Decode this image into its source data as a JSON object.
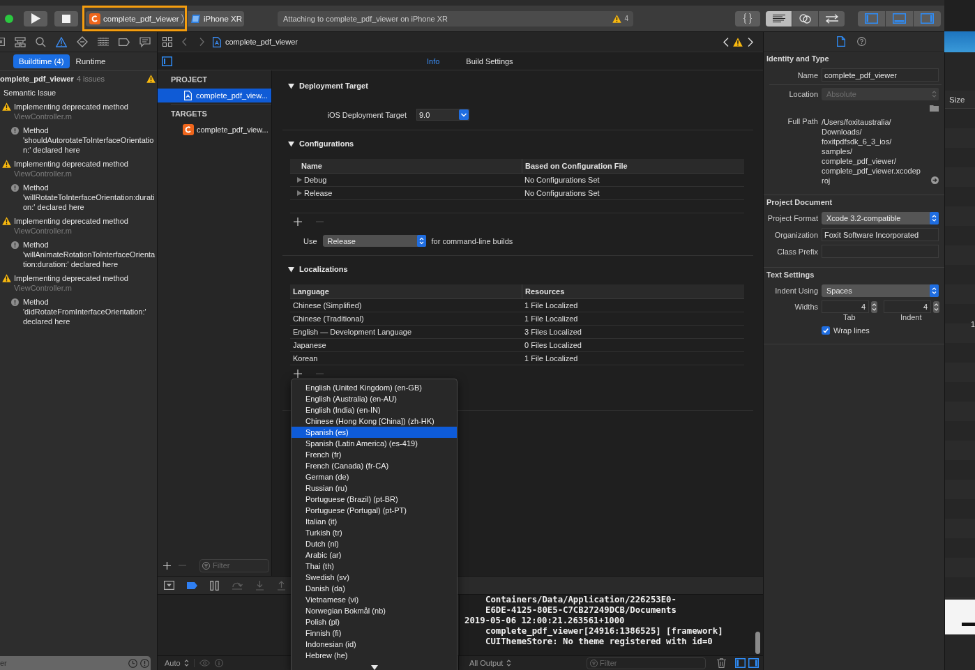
{
  "toolbar": {
    "scheme": "complete_pdf_viewer",
    "device": "iPhone XR",
    "activity": "Attaching to complete_pdf_viewer on iPhone XR",
    "warning_count": "4",
    "editor_modes": [
      {
        "kind": "standard",
        "selected": true
      },
      {
        "kind": "assistant",
        "selected": false
      },
      {
        "kind": "version",
        "selected": false
      }
    ],
    "panels": [
      {
        "kind": "navigator",
        "on": true
      },
      {
        "kind": "debug",
        "on": true
      },
      {
        "kind": "inspector",
        "on": true
      }
    ]
  },
  "navigator": {
    "icons": [
      {
        "kind": "project",
        "selected": false
      },
      {
        "kind": "symbols",
        "selected": false
      },
      {
        "kind": "find",
        "selected": false
      },
      {
        "kind": "issues",
        "selected": true
      },
      {
        "kind": "tests",
        "selected": false
      },
      {
        "kind": "debug",
        "selected": false
      },
      {
        "kind": "breakpoints",
        "selected": false
      },
      {
        "kind": "reports",
        "selected": false
      }
    ],
    "tabs": [
      {
        "label": "Buildtime (4)",
        "selected": true
      },
      {
        "label": "Runtime",
        "selected": false
      }
    ],
    "project": "omplete_pdf_viewer",
    "issue_count": "4 issues",
    "groups": [
      {
        "title": "Semantic Issue",
        "children": [
          {
            "kind": "warning",
            "message": "Implementing deprecated method",
            "file": "ViewController.m",
            "children": [
              {
                "kind": "note",
                "message": "Method 'shouldAutorotateToInterfaceOrientation:' declared here"
              }
            ]
          },
          {
            "kind": "warning",
            "message": "Implementing deprecated method",
            "file": "ViewController.m",
            "children": [
              {
                "kind": "note",
                "message": "Method 'willRotateToInterfaceOrientation:duration:' declared here"
              }
            ]
          },
          {
            "kind": "warning",
            "message": "Implementing deprecated method",
            "file": "ViewController.m",
            "children": [
              {
                "kind": "note",
                "message": "Method 'willAnimateRotationToInterfaceOrientation:duration:' declared here"
              }
            ]
          },
          {
            "kind": "warning",
            "message": "Implementing deprecated method",
            "file": "ViewController.m",
            "children": [
              {
                "kind": "note",
                "message": "Method 'didRotateFromInterfaceOrientation:' declared here"
              }
            ]
          }
        ]
      }
    ],
    "filter_placeholder": "er"
  },
  "editor": {
    "jump_bar": {
      "file": "complete_pdf_viewer"
    },
    "sidebar_on": true,
    "tabs": [
      {
        "label": "Info",
        "selected": true
      },
      {
        "label": "Build Settings",
        "selected": false
      }
    ],
    "targets_list": {
      "sections": [
        {
          "title": "PROJECT",
          "items": [
            {
              "kind": "project",
              "label": "complete_pdf_view...",
              "selected": true
            }
          ]
        },
        {
          "title": "TARGETS",
          "items": [
            {
              "kind": "app",
              "label": "complete_pdf_view...",
              "selected": false
            }
          ]
        }
      ],
      "remove_disabled": true,
      "filter_placeholder": "Filter"
    },
    "sections": [
      {
        "kind": "deployment",
        "title": "Deployment Target",
        "expanded": true,
        "label": "iOS Deployment Target",
        "value": "9.0"
      },
      {
        "kind": "configurations",
        "title": "Configurations",
        "expanded": true,
        "columns": [
          "Name",
          "Based on Configuration File"
        ],
        "rows": [
          {
            "cells": [
              "Debug",
              "No Configurations Set"
            ],
            "expanded": false
          },
          {
            "cells": [
              "Release",
              "No Configurations Set"
            ],
            "expanded": false
          }
        ],
        "remove_disabled": true,
        "use_label": "Use",
        "use_value": "Release",
        "use_suffix": "for command-line builds"
      },
      {
        "kind": "localizations",
        "title": "Localizations",
        "expanded": true,
        "columns": [
          "Language",
          "Resources"
        ],
        "rows": [
          {
            "cells": [
              "Chinese (Simplified)",
              "1 File Localized"
            ]
          },
          {
            "cells": [
              "Chinese (Traditional)",
              "1 File Localized"
            ]
          },
          {
            "cells": [
              "English — Development Language",
              "3 Files Localized"
            ]
          },
          {
            "cells": [
              "Japanese",
              "0 Files Localized"
            ]
          },
          {
            "cells": [
              "Korean",
              "1 File Localized"
            ]
          }
        ],
        "remove_disabled": true
      }
    ],
    "language_menu": [
      {
        "label": "English (United Kingdom) (en-GB)",
        "selected": false
      },
      {
        "label": "English (Australia) (en-AU)",
        "selected": false
      },
      {
        "label": "English (India) (en-IN)",
        "selected": false
      },
      {
        "label": "Chinese (Hong Kong [China]) (zh-HK)",
        "selected": false
      },
      {
        "label": "Spanish (es)",
        "selected": true
      },
      {
        "label": "Spanish (Latin America) (es-419)",
        "selected": false
      },
      {
        "label": "French (fr)",
        "selected": false
      },
      {
        "label": "French (Canada) (fr-CA)",
        "selected": false
      },
      {
        "label": "German (de)",
        "selected": false
      },
      {
        "label": "Russian (ru)",
        "selected": false
      },
      {
        "label": "Portuguese (Brazil) (pt-BR)",
        "selected": false
      },
      {
        "label": "Portuguese (Portugal) (pt-PT)",
        "selected": false
      },
      {
        "label": "Italian (it)",
        "selected": false
      },
      {
        "label": "Turkish (tr)",
        "selected": false
      },
      {
        "label": "Dutch (nl)",
        "selected": false
      },
      {
        "label": "Arabic (ar)",
        "selected": false
      },
      {
        "label": "Thai (th)",
        "selected": false
      },
      {
        "label": "Swedish (sv)",
        "selected": false
      },
      {
        "label": "Danish (da)",
        "selected": false
      },
      {
        "label": "Vietnamese (vi)",
        "selected": false
      },
      {
        "label": "Norwegian Bokmål (nb)",
        "selected": false
      },
      {
        "label": "Polish (pl)",
        "selected": false
      },
      {
        "label": "Finnish (fi)",
        "selected": false
      },
      {
        "label": "Indonesian (id)",
        "selected": false
      },
      {
        "label": "Hebrew (he)",
        "selected": false
      }
    ]
  },
  "debug_area": {
    "breakpoints_active": true,
    "console": [
      {
        "text": "Containers/Data/Application/226253E0-",
        "continued": true
      },
      {
        "text": "E6DE-4125-80E5-C7CB27249DCB/Documents",
        "continued": true
      },
      {
        "text": "2019-05-06 12:00:21.263561+1000",
        "continued": false
      },
      {
        "text": "complete_pdf_viewer[24916:1386525] [framework]",
        "continued": true
      },
      {
        "text": "CUIThemeStore: No theme registered with id=0",
        "continued": true
      }
    ],
    "variables_scope": "Auto",
    "output_scope": "All Output",
    "filter_placeholder": "Filter"
  },
  "inspector": {
    "tabs": [
      {
        "kind": "file",
        "selected": true
      },
      {
        "kind": "help",
        "selected": false
      }
    ],
    "sections": [
      {
        "title": "Identity and Type",
        "rows": [
          {
            "kind": "field",
            "label": "Name",
            "value": "complete_pdf_viewer"
          },
          {
            "kind": "popup",
            "label": "Location",
            "value": "Absolute",
            "disabled": true
          },
          {
            "kind": "path",
            "label": "Full Path",
            "value": "/Users/foxitaustralia/Downloads/foxitpdfsdk_6_3_ios/samples/complete_pdf_viewer/complete_pdf_viewer.xcodeproj"
          }
        ]
      },
      {
        "title": "Project Document",
        "rows": [
          {
            "kind": "popup",
            "label": "Project Format",
            "value": "Xcode 3.2-compatible",
            "disabled": false
          },
          {
            "kind": "field",
            "label": "Organization",
            "value": "Foxit Software Incorporated"
          },
          {
            "kind": "field",
            "label": "Class Prefix"
          }
        ]
      },
      {
        "title": "Text Settings",
        "rows": [
          {
            "kind": "popup",
            "label": "Indent Using",
            "value": "Spaces",
            "disabled": false
          },
          {
            "kind": "widths",
            "label": "Widths",
            "fields": [
              {
                "value": "4",
                "caption": "Tab"
              },
              {
                "value": "4",
                "caption": "Indent"
              }
            ]
          },
          {
            "kind": "checkbox",
            "label": "Wrap lines",
            "checked": true
          }
        ]
      }
    ]
  },
  "background_window": {
    "column": "Size",
    "cell": "1"
  }
}
